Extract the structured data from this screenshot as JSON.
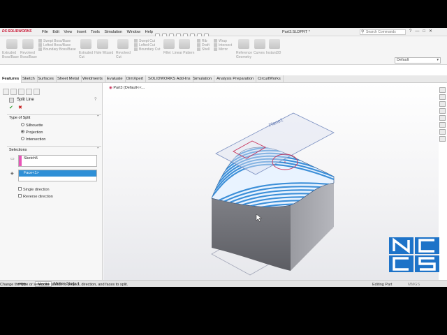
{
  "app": {
    "brand": "SOLIDWORKS",
    "brand_prefix": "DS",
    "document_title": "Part3.SLDPRT *",
    "search_placeholder": "Search Commands",
    "menu": [
      "File",
      "Edit",
      "View",
      "Insert",
      "Tools",
      "Simulation",
      "Window",
      "Help"
    ],
    "window_controls": [
      "?",
      "—",
      "□",
      "✕"
    ]
  },
  "ribbon": {
    "groups": [
      {
        "lines": [
          "Extruded",
          "Boss/Base"
        ]
      },
      {
        "lines": [
          "Revolved",
          "Boss/Base"
        ]
      },
      {
        "lines": [
          "Swept Boss/Base",
          "Lofted Boss/Base",
          "Boundary Boss/Base"
        ]
      },
      {
        "lines": [
          "Extruded",
          "Cut"
        ]
      },
      {
        "lines": [
          "Hole Wizard"
        ]
      },
      {
        "lines": [
          "Revolved",
          "Cut"
        ]
      },
      {
        "lines": [
          "Swept Cut",
          "Lofted Cut",
          "Boundary Cut"
        ]
      },
      {
        "lines": [
          "Fillet"
        ]
      },
      {
        "lines": [
          "Linear Pattern"
        ]
      },
      {
        "lines": [
          "Rib",
          "Draft",
          "Shell"
        ]
      },
      {
        "lines": [
          "Wrap",
          "Intersect",
          "Mirror"
        ]
      },
      {
        "lines": [
          "Reference",
          "Geometry"
        ]
      },
      {
        "lines": [
          "Curves"
        ]
      },
      {
        "lines": [
          "Instant3D"
        ]
      }
    ],
    "configuration": "Default"
  },
  "tabs": [
    "Features",
    "Sketch",
    "Surfaces",
    "Sheet Metal",
    "Weldments",
    "Evaluate",
    "DimXpert",
    "SOLIDWORKS Add-Ins",
    "Simulation",
    "Analysis Preparation",
    "CircuitWorks"
  ],
  "active_tab": "Features",
  "property_manager": {
    "title": "Split Line",
    "help": "?",
    "ok": "✔",
    "cancel": "✖",
    "type_section": "Type of Split",
    "types": [
      "Silhouette",
      "Projection",
      "Intersection"
    ],
    "selected_type": "Projection",
    "selections_section": "Selections",
    "sketch_item": "Sketch5",
    "face_item": "Face<1>",
    "single_direction": "Single direction",
    "reverse_direction": "Reverse direction"
  },
  "viewport": {
    "breadcrumb": "Part3 (Default<<...",
    "plane_label": "Plane1"
  },
  "bottom_tabs": [
    "Model",
    "Motion Study 1"
  ],
  "active_bottom_tab": "Model",
  "status": {
    "message": "Change the type or select the sketch to project, direction, and faces to split.",
    "mode": "Editing Part",
    "units": "MMGS"
  },
  "watermark": {
    "letters": [
      "N",
      "C",
      "C",
      "S"
    ]
  },
  "colors": {
    "accent_blue": "#2e8fd6",
    "selection_pink": "#e855b8",
    "face_stripe": "#3c8fd8",
    "plane_outline": "#7a8fc0",
    "sketch_red": "#c8335a",
    "logo_blue": "#1e73c8"
  }
}
